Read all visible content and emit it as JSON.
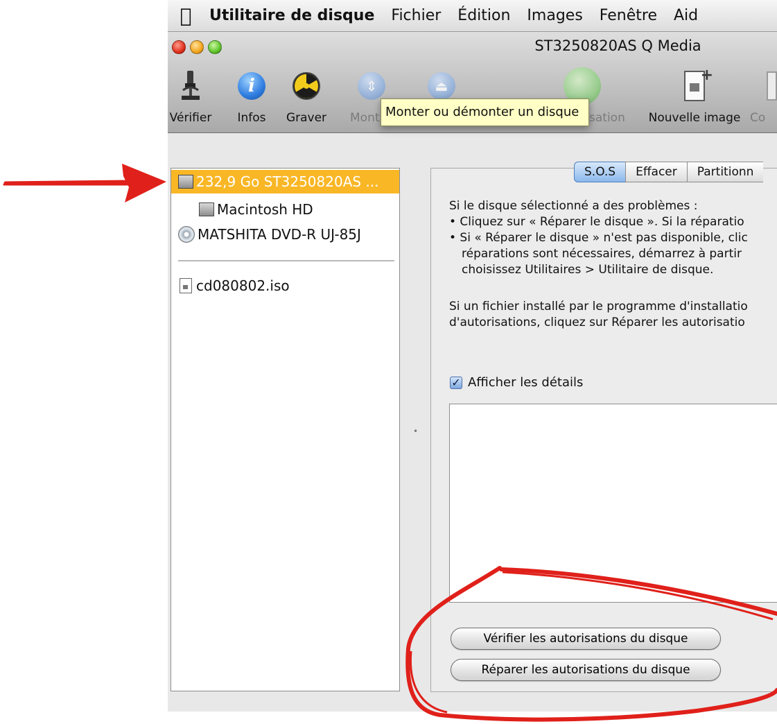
{
  "menubar": {
    "apple_icon": "apple-icon",
    "app_name": "Utilitaire de disque",
    "items": [
      "Fichier",
      "Édition",
      "Images",
      "Fenêtre",
      "Aid"
    ]
  },
  "window": {
    "title": "ST3250820AS Q Media"
  },
  "toolbar": {
    "items": [
      {
        "label": "Vérifier",
        "icon": "microscope-icon",
        "enabled": true
      },
      {
        "label": "Infos",
        "icon": "info-icon",
        "enabled": true
      },
      {
        "label": "Graver",
        "icon": "burn-icon",
        "enabled": true
      },
      {
        "label": "Mont",
        "icon": "mount-icon",
        "enabled": false
      },
      {
        "label": "",
        "icon": "eject-icon",
        "enabled": false
      },
      {
        "label": "sation",
        "icon": "enable-journaling-icon",
        "enabled": false
      },
      {
        "label": "Nouvelle image",
        "icon": "new-image-icon",
        "enabled": true
      },
      {
        "label": "Co",
        "icon": "convert-icon",
        "enabled": false
      }
    ],
    "tooltip": "Monter ou démonter un disque"
  },
  "sidebar": {
    "items": [
      {
        "label": "232,9 Go ST3250820AS ...",
        "icon": "hard-disk-icon",
        "selected": true
      },
      {
        "label": "Macintosh HD",
        "icon": "volume-icon",
        "selected": false
      },
      {
        "label": "MATSHITA DVD-R UJ-85J",
        "icon": "dvd-drive-icon",
        "selected": false
      },
      {
        "label": "cd080802.iso",
        "icon": "disk-image-file-icon",
        "selected": false
      }
    ]
  },
  "tabs": {
    "items": [
      "S.O.S",
      "Effacer",
      "Partitionn"
    ],
    "active": "S.O.S"
  },
  "first_aid": {
    "intro": "Si le disque sélectionné a des problèmes :",
    "bullet1": "• Cliquez sur « Réparer le disque ». Si la réparatio",
    "bullet2_line1": "• Si « Réparer le disque » n'est pas disponible, clic",
    "bullet2_line2": "réparations sont nécessaires, démarrez à partir",
    "bullet2_line3": "choisissez Utilitaires > Utilitaire de disque.",
    "perm_line1": "Si un fichier installé par le programme d'installatio",
    "perm_line2": "d'autorisations, cliquez sur Réparer les autorisatio",
    "show_details_label": "Afficher les détails",
    "show_details_checked": true,
    "verify_permissions_button": "Vérifier les autorisations du disque",
    "repair_permissions_button": "Réparer les autorisations du disque"
  },
  "annotation": {
    "color": "#e0201a"
  }
}
